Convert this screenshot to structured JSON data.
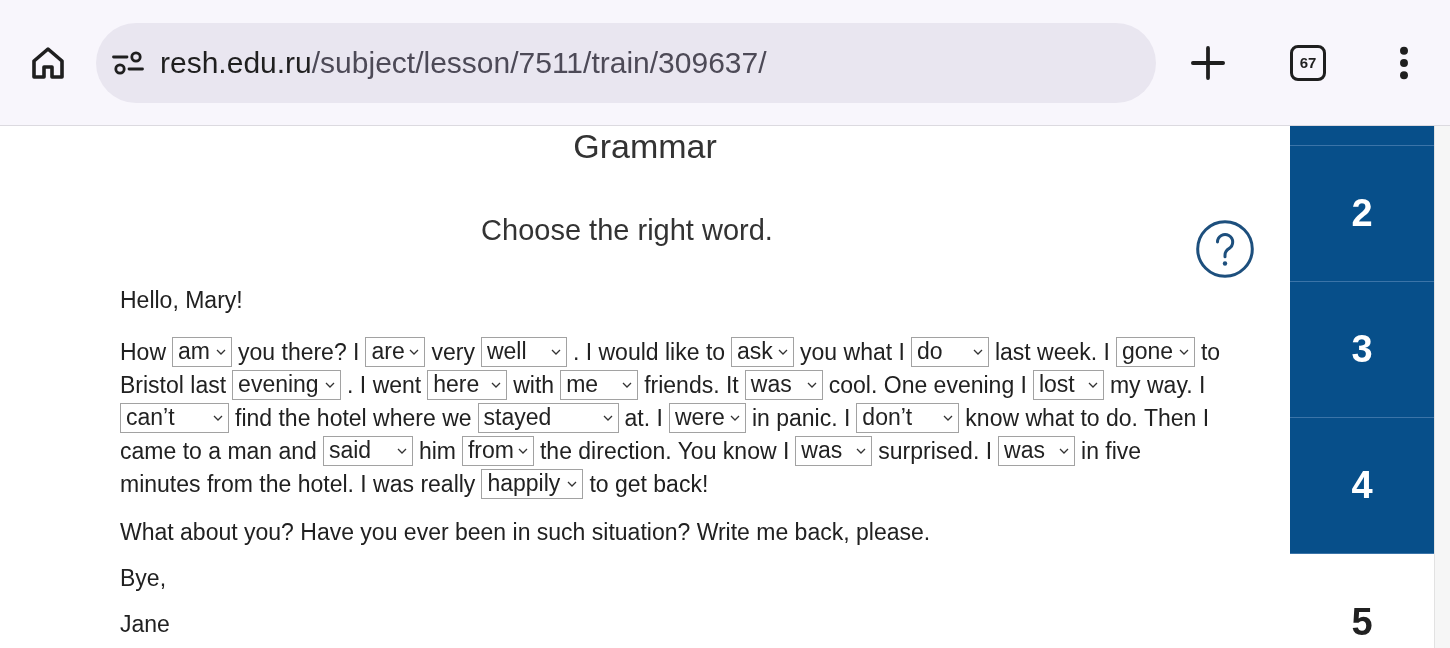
{
  "browser": {
    "url_host": "resh.edu.ru",
    "url_path": "/subject/lesson/7511/train/309637/",
    "tab_count": "67"
  },
  "lesson": {
    "title": "Grammar",
    "instruction": "Choose the right word.",
    "greeting": "Hello, Mary!",
    "lines": [
      [
        {
          "kind": "text",
          "text": "How"
        },
        {
          "kind": "select",
          "value": "am"
        },
        {
          "kind": "text",
          "text": "you there? I"
        },
        {
          "kind": "select",
          "value": "are"
        },
        {
          "kind": "text",
          "text": "very"
        },
        {
          "kind": "select",
          "value": "well"
        },
        {
          "kind": "text",
          "text": ". I would like to"
        },
        {
          "kind": "select",
          "value": "ask"
        },
        {
          "kind": "text",
          "text": "you what I"
        },
        {
          "kind": "select",
          "value": "do"
        },
        {
          "kind": "text",
          "text": "last week. I"
        },
        {
          "kind": "select",
          "value": "gone"
        },
        {
          "kind": "text",
          "text": "to"
        }
      ],
      [
        {
          "kind": "text",
          "text": "Bristol last"
        },
        {
          "kind": "select",
          "value": "evening"
        },
        {
          "kind": "text",
          "text": ". I went"
        },
        {
          "kind": "select",
          "value": "here"
        },
        {
          "kind": "text",
          "text": "with"
        },
        {
          "kind": "select",
          "value": "me"
        },
        {
          "kind": "text",
          "text": "friends. It"
        },
        {
          "kind": "select",
          "value": "was"
        },
        {
          "kind": "text",
          "text": "cool. One evening I"
        },
        {
          "kind": "select",
          "value": "lost"
        },
        {
          "kind": "text",
          "text": "my way. I"
        }
      ],
      [
        {
          "kind": "select",
          "value": "can’t"
        },
        {
          "kind": "text",
          "text": "find the hotel where we"
        },
        {
          "kind": "select",
          "value": "stayed"
        },
        {
          "kind": "text",
          "text": "at. I"
        },
        {
          "kind": "select",
          "value": "were"
        },
        {
          "kind": "text",
          "text": "in panic. I"
        },
        {
          "kind": "select",
          "value": "don’t"
        },
        {
          "kind": "text",
          "text": "know what to do. Then I"
        }
      ],
      [
        {
          "kind": "text",
          "text": "came to a man and"
        },
        {
          "kind": "select",
          "value": "said"
        },
        {
          "kind": "text",
          "text": "him"
        },
        {
          "kind": "select",
          "value": "from"
        },
        {
          "kind": "text",
          "text": "the direction. You know I"
        },
        {
          "kind": "select",
          "value": "was"
        },
        {
          "kind": "text",
          "text": "surprised. I"
        },
        {
          "kind": "select",
          "value": "was"
        },
        {
          "kind": "text",
          "text": "in five"
        }
      ],
      [
        {
          "kind": "text",
          "text": "minutes from the hotel. I was really"
        },
        {
          "kind": "select",
          "value": "happily"
        },
        {
          "kind": "text",
          "text": "to get back!"
        }
      ]
    ],
    "paragraphs": [
      "What about you? Have you ever been in such situation? Write me back, please.",
      "Bye,",
      "Jane"
    ]
  },
  "steps": [
    {
      "done": true
    },
    {
      "label": "2",
      "done": true
    },
    {
      "label": "3",
      "done": true
    },
    {
      "label": "4",
      "done": true
    },
    {
      "label": "5",
      "done": false
    }
  ]
}
